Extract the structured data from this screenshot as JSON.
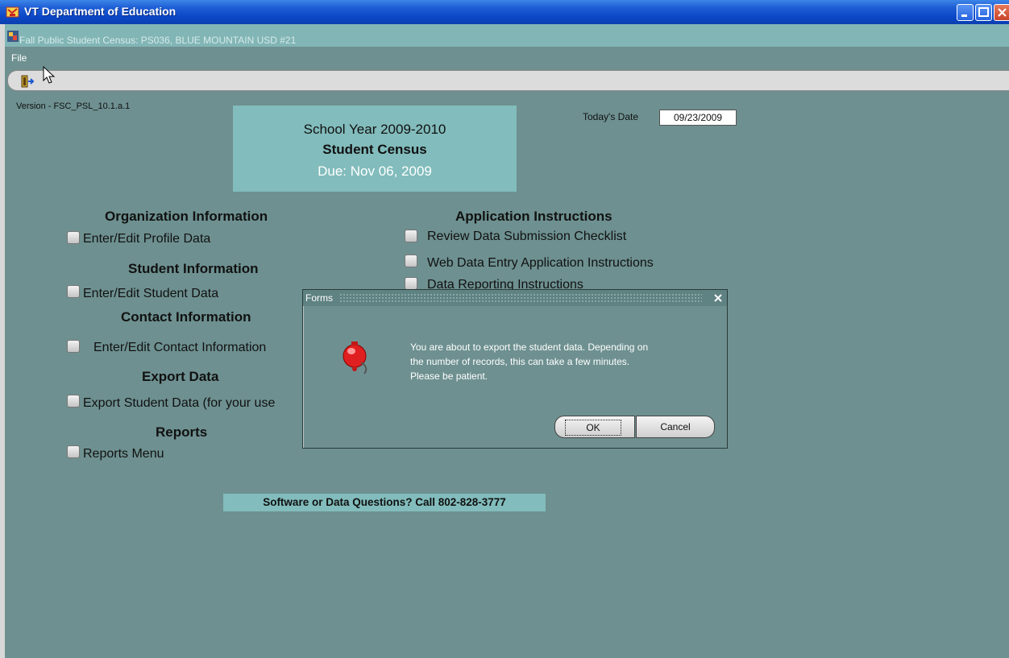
{
  "window": {
    "title": "VT Department of Education",
    "subtitle": "Fall Public Student Census:  PS036, BLUE MOUNTAIN USD #21"
  },
  "menu": {
    "file": "File"
  },
  "version": "Version - FSC_PSL_10.1.a.1",
  "banner": {
    "school_year": "School Year 2009-2010",
    "title": "Student Census",
    "due": "Due:  Nov 06, 2009"
  },
  "today": {
    "label": "Today's Date",
    "value": "09/23/2009"
  },
  "sections": {
    "organization": {
      "heading": "Organization Information",
      "item": "Enter/Edit Profile Data"
    },
    "student": {
      "heading": "Student Information",
      "item": "Enter/Edit Student Data"
    },
    "contact": {
      "heading": "Contact Information",
      "item": "Enter/Edit Contact Information"
    },
    "export": {
      "heading": "Export Data",
      "item": "Export Student Data (for your use"
    },
    "reports": {
      "heading": "Reports",
      "item": "Reports Menu"
    },
    "instructions": {
      "heading": "Application Instructions",
      "items": [
        "Review Data Submission Checklist",
        "Web Data Entry Application Instructions",
        "Data Reporting Instructions"
      ]
    }
  },
  "help": "Software or Data Questions?  Call 802-828-3777",
  "dialog": {
    "title": "Forms",
    "message_lines": [
      "You are about to export the student data.  Depending on",
      "the number of records, this can take a few minutes.",
      "Please be patient."
    ],
    "ok_label": "OK",
    "cancel_label": "Cancel"
  },
  "colors": {
    "background": "#6e9090",
    "accent": "#82bcbc",
    "titlebar": "#0a47c7"
  },
  "icons": [
    "app-icon",
    "forms-icon",
    "exit-icon",
    "bell-icon",
    "close-icon",
    "minimize-icon",
    "maximize-icon",
    "mouse-cursor-icon"
  ]
}
